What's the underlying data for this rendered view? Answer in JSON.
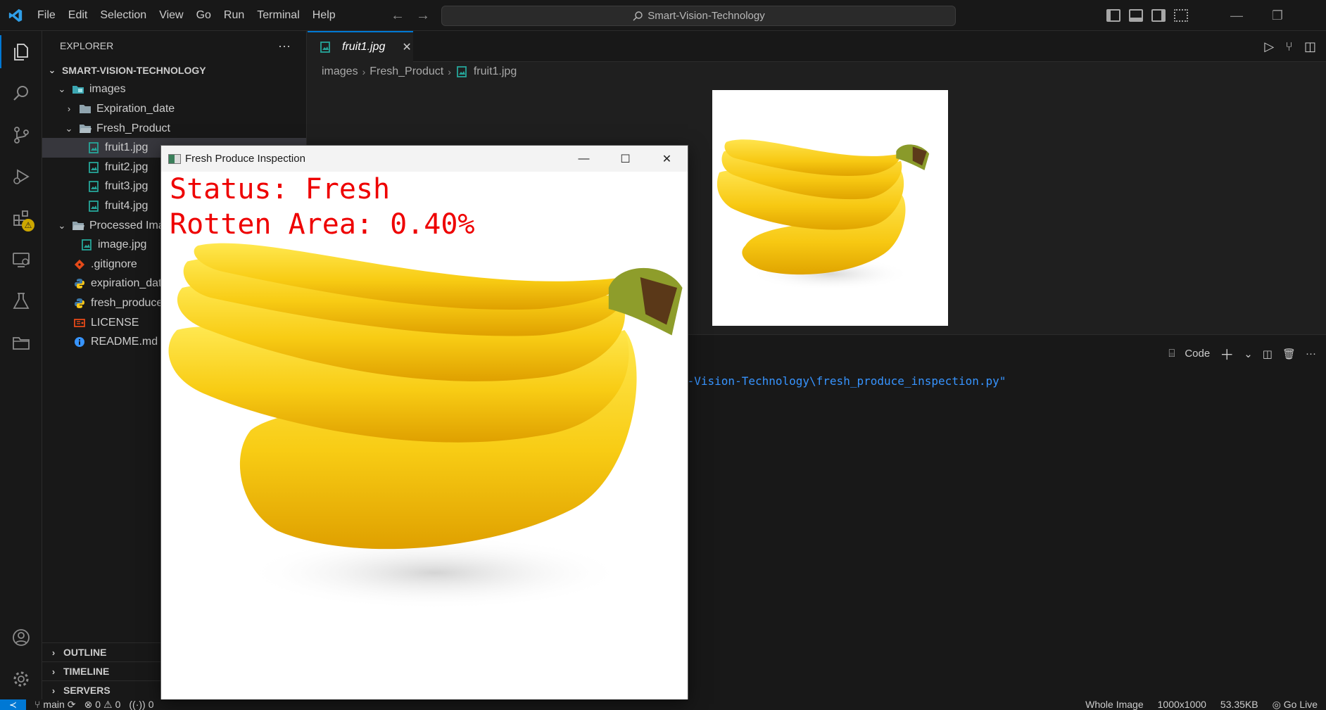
{
  "titlebar": {
    "menu": [
      "File",
      "Edit",
      "Selection",
      "View",
      "Go",
      "Run",
      "Terminal",
      "Help"
    ],
    "search_text": "Smart-Vision-Technology",
    "icons": [
      "vscode-logo-icon",
      "back-arrow-icon",
      "forward-arrow-icon",
      "search-icon",
      "layout-icons",
      "minimize-icon",
      "restore-icon"
    ]
  },
  "activity_bar": {
    "items": [
      "explorer-icon",
      "search-icon",
      "source-control-icon",
      "run-debug-icon",
      "extensions-icon",
      "remote-explorer-icon",
      "testing-icon",
      "folder-icon"
    ],
    "bottom": [
      "account-icon",
      "settings-icon"
    ],
    "warning_badge": "⚠"
  },
  "sidebar": {
    "header": "EXPLORER",
    "more": "···",
    "root": "SMART-VISION-TECHNOLOGY",
    "items": [
      {
        "label": "images",
        "type": "folder-open"
      },
      {
        "label": "Expiration_date",
        "type": "folder-closed"
      },
      {
        "label": "Fresh_Product",
        "type": "folder-open"
      },
      {
        "label": "fruit1.jpg",
        "type": "image"
      },
      {
        "label": "fruit2.jpg",
        "type": "image"
      },
      {
        "label": "fruit3.jpg",
        "type": "image"
      },
      {
        "label": "fruit4.jpg",
        "type": "image"
      },
      {
        "label": "Processed Ima",
        "type": "folder-open"
      },
      {
        "label": "image.jpg",
        "type": "image"
      },
      {
        "label": ".gitignore",
        "type": "git"
      },
      {
        "label": "expiration_dat",
        "type": "python"
      },
      {
        "label": "fresh_produce",
        "type": "python"
      },
      {
        "label": "LICENSE",
        "type": "license"
      },
      {
        "label": "README.md",
        "type": "info"
      }
    ],
    "sections": [
      "OUTLINE",
      "TIMELINE",
      "SERVERS"
    ]
  },
  "editor": {
    "tab_label": "fruit1.jpg",
    "tab_close": "✕",
    "breadcrumb": [
      "images",
      "Fresh_Product",
      "fruit1.jpg"
    ]
  },
  "panel": {
    "terminal_profile": "Code",
    "terminal_line": "t-Vision-Technology\\fresh_produce_inspection.py\""
  },
  "statusbar": {
    "branch": "main",
    "errors": "0",
    "warnings": "0",
    "ports": "0",
    "right": [
      "Whole Image",
      "1000x1000",
      "53.35KB",
      "Go Live"
    ]
  },
  "cv_window": {
    "title": "Fresh Produce Inspection",
    "status_text": "Status: Fresh",
    "rotten_text": "Rotten Area: 0.40%"
  },
  "colors": {
    "accent": "#0078d4",
    "overlay_text": "#ee0000",
    "banana": "#f7d31a"
  }
}
